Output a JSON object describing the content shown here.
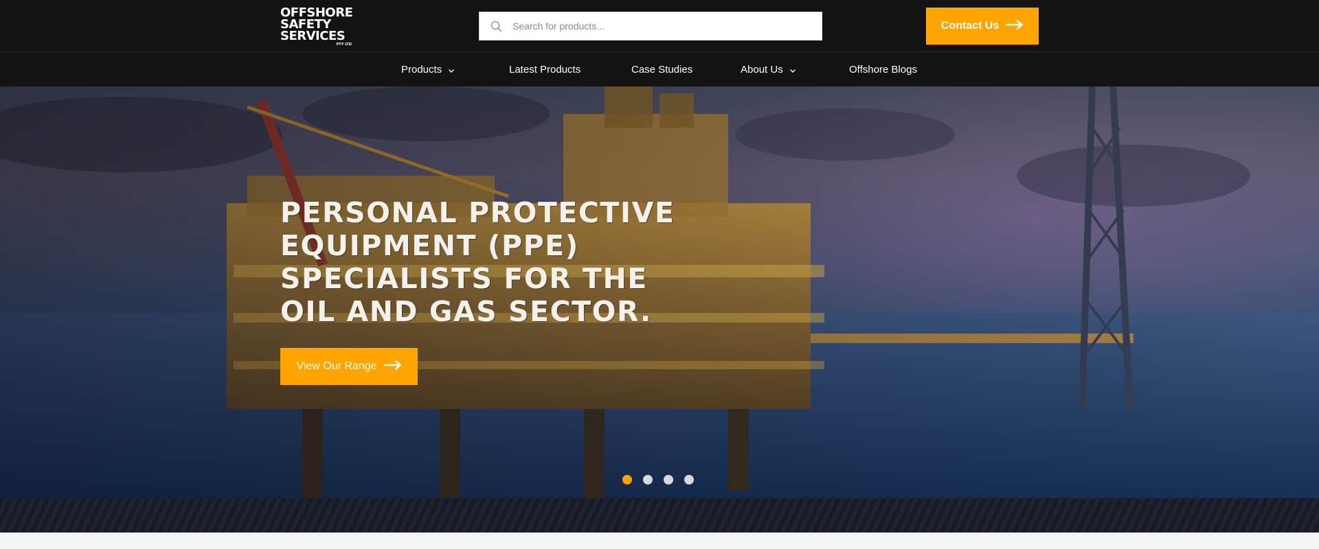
{
  "brand": {
    "logo_lines": [
      "Offshore",
      "Safety",
      "Services"
    ],
    "logo_suffix": "PTY LTD",
    "accent_color": "#ffa400"
  },
  "search": {
    "placeholder": "Search for products...",
    "value": "",
    "icon": "search-icon"
  },
  "header": {
    "contact_label": "Contact Us",
    "contact_icon": "arrow-right-icon"
  },
  "nav": {
    "items": [
      {
        "label": "Products",
        "has_dropdown": true
      },
      {
        "label": "Latest Products",
        "has_dropdown": false
      },
      {
        "label": "Case Studies",
        "has_dropdown": false
      },
      {
        "label": "About Us",
        "has_dropdown": true
      },
      {
        "label": "Offshore Blogs",
        "has_dropdown": false
      }
    ]
  },
  "hero": {
    "title": "Personal Protective Equipment (PPE) Specialists for the Oil and Gas Sector.",
    "cta_label": "View Our Range",
    "cta_icon": "arrow-right-icon",
    "slides": {
      "count": 4,
      "active_index": 0
    }
  }
}
